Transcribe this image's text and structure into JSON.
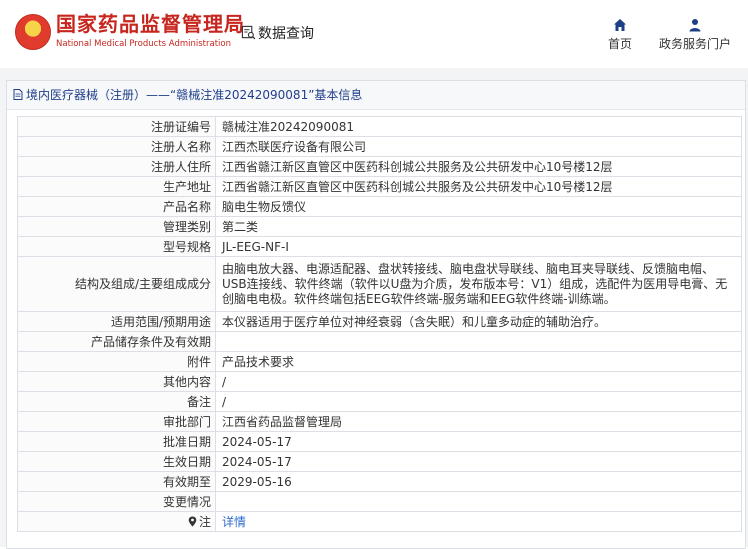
{
  "header": {
    "org_name_cn": "国家药品监督管理局",
    "org_name_en": "National Medical Products Administration",
    "data_query": "数据查询",
    "nav": [
      {
        "label": "首页",
        "icon": "home-icon"
      },
      {
        "label": "政务服务门户",
        "icon": "user-icon"
      }
    ]
  },
  "panel": {
    "title": "境内医疗器械（注册）——“赣械注准20242090081”基本信息"
  },
  "rows": [
    {
      "label": "注册证编号",
      "value": "赣械注准20242090081"
    },
    {
      "label": "注册人名称",
      "value": "江西杰联医疗设备有限公司"
    },
    {
      "label": "注册人住所",
      "value": "江西省赣江新区直管区中医药科创城公共服务及公共研发中心10号楼12层"
    },
    {
      "label": "生产地址",
      "value": "江西省赣江新区直管区中医药科创城公共服务及公共研发中心10号楼12层"
    },
    {
      "label": "产品名称",
      "value": "脑电生物反馈仪"
    },
    {
      "label": "管理类别",
      "value": "第二类"
    },
    {
      "label": "型号规格",
      "value": "JL-EEG-NF-Ⅰ"
    },
    {
      "label": "结构及组成/主要组成成分",
      "value": "由脑电放大器、电源适配器、盘状转接线、脑电盘状导联线、脑电耳夹导联线、反馈脑电帽、USB连接线、软件终端（软件以U盘为介质，发布版本号：V1）组成，选配件为医用导电膏、无创脑电电极。软件终端包括EEG软件终端-服务端和EEG软件终端-训练端。"
    },
    {
      "label": "适用范围/预期用途",
      "value": "本仪器适用于医疗单位对神经衰弱（含失眠）和儿童多动症的辅助治疗。"
    },
    {
      "label": "产品储存条件及有效期",
      "value": ""
    },
    {
      "label": "附件",
      "value": "产品技术要求"
    },
    {
      "label": "其他内容",
      "value": "/"
    },
    {
      "label": "备注",
      "value": "/"
    },
    {
      "label": "审批部门",
      "value": "江西省药品监督管理局"
    },
    {
      "label": "批准日期",
      "value": "2024-05-17"
    },
    {
      "label": "生效日期",
      "value": "2024-05-17"
    },
    {
      "label": "有效期至",
      "value": "2029-05-16"
    },
    {
      "label": "变更情况",
      "value": ""
    },
    {
      "label": "注",
      "value": "详情",
      "icon": "info-pin-icon"
    }
  ]
}
